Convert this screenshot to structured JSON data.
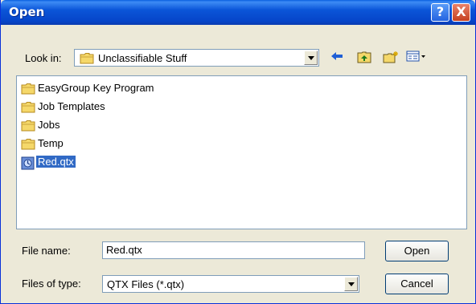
{
  "dialog": {
    "title": "Open",
    "help_glyph": "?",
    "close_glyph": "X"
  },
  "look_in": {
    "label": "Look in:",
    "value": "Unclassifiable Stuff"
  },
  "toolbar": {
    "icons": [
      "back-arrow-icon",
      "up-folder-icon",
      "new-folder-icon",
      "view-menu-icon"
    ]
  },
  "files": [
    {
      "name": "EasyGroup Key Program",
      "type": "folder"
    },
    {
      "name": "Job Templates",
      "type": "folder"
    },
    {
      "name": "Jobs",
      "type": "folder"
    },
    {
      "name": "Temp",
      "type": "folder"
    },
    {
      "name": "Red.qtx",
      "type": "file",
      "selected": true
    }
  ],
  "file_name": {
    "label": "File name:",
    "value": "Red.qtx"
  },
  "file_type": {
    "label": "Files of type:",
    "value": "QTX Files (*.qtx)"
  },
  "buttons": {
    "open": "Open",
    "cancel": "Cancel"
  },
  "colors": {
    "titlebar": "#0b55d8",
    "selection": "#316ac5",
    "folder": "#f5d86a"
  }
}
